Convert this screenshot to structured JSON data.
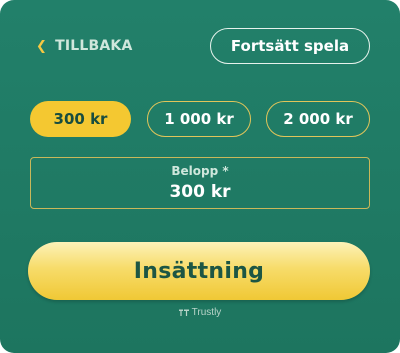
{
  "header": {
    "back_label": "TILLBAKA",
    "continue_label": "Fortsätt spela"
  },
  "amount_options": [
    {
      "label": "300 kr",
      "selected": true
    },
    {
      "label": "1 000 kr",
      "selected": false
    },
    {
      "label": "2 000 kr",
      "selected": false
    }
  ],
  "amount_field": {
    "label": "Belopp *",
    "value": "300 kr"
  },
  "deposit_button": {
    "label": "Insättning"
  },
  "provider": {
    "name": "Trustly",
    "icon": "trustly-logo-icon"
  },
  "colors": {
    "panel_green": "#1f7a63",
    "accent_yellow": "#f4c831",
    "button_text_green": "#1d5644"
  }
}
